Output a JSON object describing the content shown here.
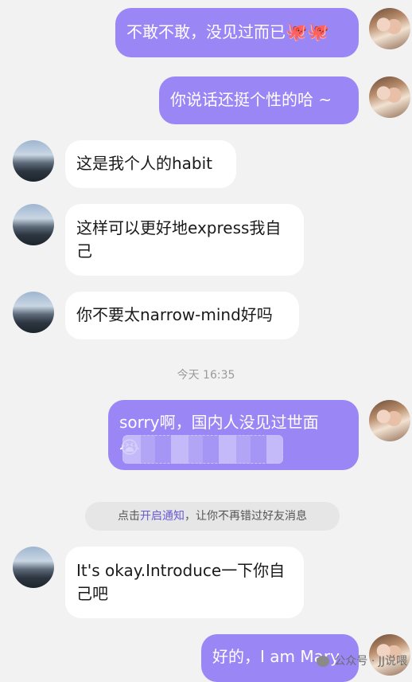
{
  "messages": [
    {
      "side": "me",
      "text": "不敢不敢，没见过而已",
      "emoji": "🐙🐙"
    },
    {
      "side": "me",
      "text": "你说话还挺个性的哈 ~"
    },
    {
      "side": "other",
      "text": "这是我个人的habit"
    },
    {
      "side": "other",
      "text": "这样可以更好地express我自己"
    },
    {
      "side": "other",
      "text": "你不要太narrow-mind好吗"
    },
    {
      "side": "me",
      "text": "sorry啊，国内人没见过世面",
      "emoji": "😭"
    },
    {
      "side": "other",
      "text": "It's okay.Introduce一下你自己吧"
    },
    {
      "side": "me",
      "text": "好的，I am Mary"
    }
  ],
  "timestamp": "今天 16:35",
  "notice": {
    "prefix": "点击",
    "link": "开启通知",
    "suffix": "，让你不再错过好友消息"
  },
  "watermark": "公众号 · JJ说喂",
  "colors": {
    "me_bubble": "#9a86f5",
    "other_bubble": "#ffffff",
    "background": "#f2f2f2"
  }
}
